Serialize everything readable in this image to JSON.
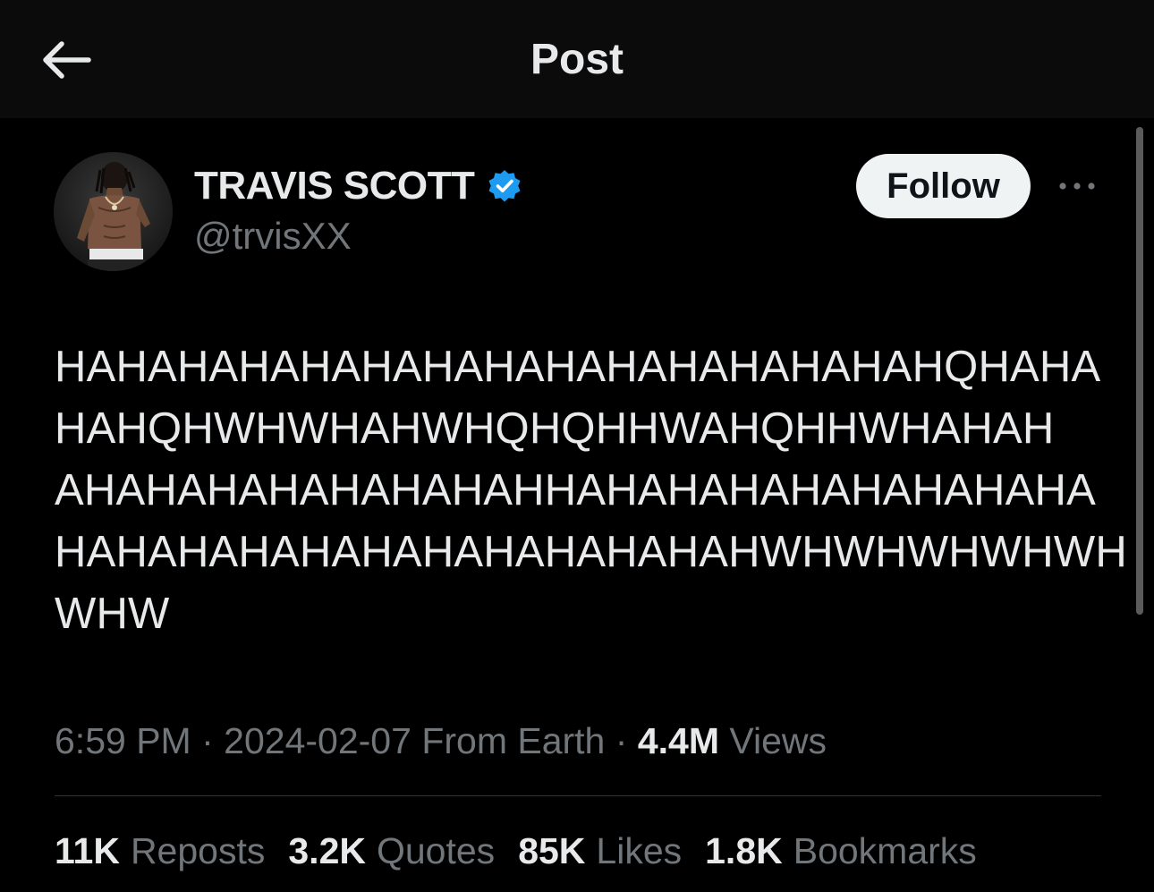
{
  "header": {
    "title": "Post",
    "back_icon": "arrow-left-icon"
  },
  "author": {
    "display_name": "TRAVIS SCOTT",
    "handle": "@trvisXX",
    "verified_icon": "verified-badge-icon",
    "verified_color": "#1d9bf0"
  },
  "actions": {
    "follow_label": "Follow",
    "more_icon": "more-horizontal-icon"
  },
  "post": {
    "text_lines": [
      "HAHAHAHAHAHAHAHAHAHAHAHAHAHAHQHAHA",
      "HAHQHWHWHAHWHQHQHHWAHQHHWHAHAH",
      "AHAHAHAHAHAHAHAHHAHAHAHAHAHAHAHAHA",
      "HAHAHAHAHAHAHAHAHAHAHAHWHWHWHWHWH",
      "WHW"
    ]
  },
  "meta": {
    "time": "6:59 PM",
    "separator": "·",
    "date": "2024-02-07",
    "location": "From Earth",
    "views_count": "4.4M",
    "views_label": "Views"
  },
  "stats": {
    "reposts_count": "11K",
    "reposts_label": "Reposts",
    "quotes_count": "3.2K",
    "quotes_label": "Quotes",
    "likes_count": "85K",
    "likes_label": "Likes",
    "bookmarks_count": "1.8K",
    "bookmarks_label": "Bookmarks"
  },
  "colors": {
    "background": "#000000",
    "header_background": "#0b0b0b",
    "primary_text": "#e7e9ea",
    "secondary_text": "#71767b",
    "follow_button_bg": "#eff3f4"
  }
}
